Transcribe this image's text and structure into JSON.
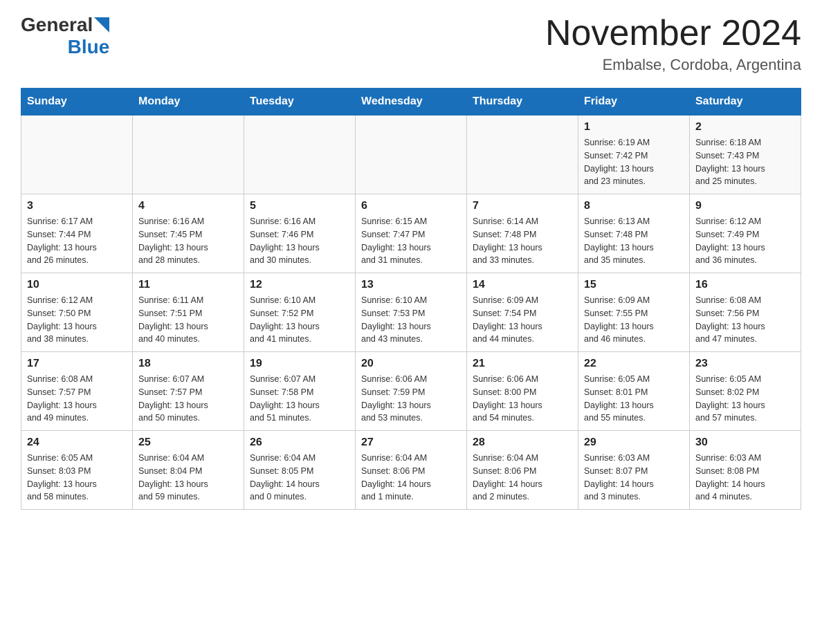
{
  "header": {
    "logo": {
      "text_general": "General",
      "text_blue": "Blue",
      "aria": "GeneralBlue logo"
    },
    "title": "November 2024",
    "subtitle": "Embalse, Cordoba, Argentina"
  },
  "calendar": {
    "weekdays": [
      "Sunday",
      "Monday",
      "Tuesday",
      "Wednesday",
      "Thursday",
      "Friday",
      "Saturday"
    ],
    "weeks": [
      [
        {
          "day": "",
          "info": ""
        },
        {
          "day": "",
          "info": ""
        },
        {
          "day": "",
          "info": ""
        },
        {
          "day": "",
          "info": ""
        },
        {
          "day": "",
          "info": ""
        },
        {
          "day": "1",
          "info": "Sunrise: 6:19 AM\nSunset: 7:42 PM\nDaylight: 13 hours\nand 23 minutes."
        },
        {
          "day": "2",
          "info": "Sunrise: 6:18 AM\nSunset: 7:43 PM\nDaylight: 13 hours\nand 25 minutes."
        }
      ],
      [
        {
          "day": "3",
          "info": "Sunrise: 6:17 AM\nSunset: 7:44 PM\nDaylight: 13 hours\nand 26 minutes."
        },
        {
          "day": "4",
          "info": "Sunrise: 6:16 AM\nSunset: 7:45 PM\nDaylight: 13 hours\nand 28 minutes."
        },
        {
          "day": "5",
          "info": "Sunrise: 6:16 AM\nSunset: 7:46 PM\nDaylight: 13 hours\nand 30 minutes."
        },
        {
          "day": "6",
          "info": "Sunrise: 6:15 AM\nSunset: 7:47 PM\nDaylight: 13 hours\nand 31 minutes."
        },
        {
          "day": "7",
          "info": "Sunrise: 6:14 AM\nSunset: 7:48 PM\nDaylight: 13 hours\nand 33 minutes."
        },
        {
          "day": "8",
          "info": "Sunrise: 6:13 AM\nSunset: 7:48 PM\nDaylight: 13 hours\nand 35 minutes."
        },
        {
          "day": "9",
          "info": "Sunrise: 6:12 AM\nSunset: 7:49 PM\nDaylight: 13 hours\nand 36 minutes."
        }
      ],
      [
        {
          "day": "10",
          "info": "Sunrise: 6:12 AM\nSunset: 7:50 PM\nDaylight: 13 hours\nand 38 minutes."
        },
        {
          "day": "11",
          "info": "Sunrise: 6:11 AM\nSunset: 7:51 PM\nDaylight: 13 hours\nand 40 minutes."
        },
        {
          "day": "12",
          "info": "Sunrise: 6:10 AM\nSunset: 7:52 PM\nDaylight: 13 hours\nand 41 minutes."
        },
        {
          "day": "13",
          "info": "Sunrise: 6:10 AM\nSunset: 7:53 PM\nDaylight: 13 hours\nand 43 minutes."
        },
        {
          "day": "14",
          "info": "Sunrise: 6:09 AM\nSunset: 7:54 PM\nDaylight: 13 hours\nand 44 minutes."
        },
        {
          "day": "15",
          "info": "Sunrise: 6:09 AM\nSunset: 7:55 PM\nDaylight: 13 hours\nand 46 minutes."
        },
        {
          "day": "16",
          "info": "Sunrise: 6:08 AM\nSunset: 7:56 PM\nDaylight: 13 hours\nand 47 minutes."
        }
      ],
      [
        {
          "day": "17",
          "info": "Sunrise: 6:08 AM\nSunset: 7:57 PM\nDaylight: 13 hours\nand 49 minutes."
        },
        {
          "day": "18",
          "info": "Sunrise: 6:07 AM\nSunset: 7:57 PM\nDaylight: 13 hours\nand 50 minutes."
        },
        {
          "day": "19",
          "info": "Sunrise: 6:07 AM\nSunset: 7:58 PM\nDaylight: 13 hours\nand 51 minutes."
        },
        {
          "day": "20",
          "info": "Sunrise: 6:06 AM\nSunset: 7:59 PM\nDaylight: 13 hours\nand 53 minutes."
        },
        {
          "day": "21",
          "info": "Sunrise: 6:06 AM\nSunset: 8:00 PM\nDaylight: 13 hours\nand 54 minutes."
        },
        {
          "day": "22",
          "info": "Sunrise: 6:05 AM\nSunset: 8:01 PM\nDaylight: 13 hours\nand 55 minutes."
        },
        {
          "day": "23",
          "info": "Sunrise: 6:05 AM\nSunset: 8:02 PM\nDaylight: 13 hours\nand 57 minutes."
        }
      ],
      [
        {
          "day": "24",
          "info": "Sunrise: 6:05 AM\nSunset: 8:03 PM\nDaylight: 13 hours\nand 58 minutes."
        },
        {
          "day": "25",
          "info": "Sunrise: 6:04 AM\nSunset: 8:04 PM\nDaylight: 13 hours\nand 59 minutes."
        },
        {
          "day": "26",
          "info": "Sunrise: 6:04 AM\nSunset: 8:05 PM\nDaylight: 14 hours\nand 0 minutes."
        },
        {
          "day": "27",
          "info": "Sunrise: 6:04 AM\nSunset: 8:06 PM\nDaylight: 14 hours\nand 1 minute."
        },
        {
          "day": "28",
          "info": "Sunrise: 6:04 AM\nSunset: 8:06 PM\nDaylight: 14 hours\nand 2 minutes."
        },
        {
          "day": "29",
          "info": "Sunrise: 6:03 AM\nSunset: 8:07 PM\nDaylight: 14 hours\nand 3 minutes."
        },
        {
          "day": "30",
          "info": "Sunrise: 6:03 AM\nSunset: 8:08 PM\nDaylight: 14 hours\nand 4 minutes."
        }
      ]
    ]
  }
}
